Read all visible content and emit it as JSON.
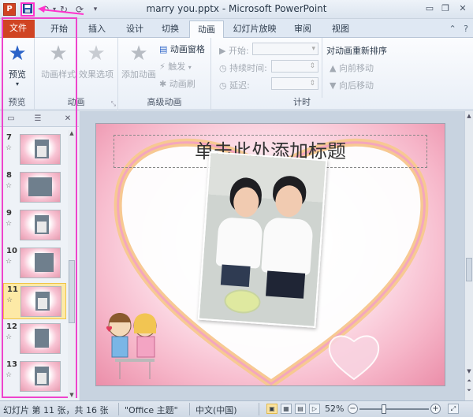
{
  "window": {
    "title": "marry you.pptx - Microsoft PowerPoint",
    "app_icon": "P",
    "controls": [
      "minimize-icon",
      "restore-icon",
      "close-icon"
    ]
  },
  "quick_access": {
    "icons": [
      "save-icon",
      "undo-icon",
      "redo-icon",
      "repeat-icon",
      "customize-dropdown-icon"
    ]
  },
  "tabs": [
    {
      "label": "文件",
      "type": "file"
    },
    {
      "label": "开始"
    },
    {
      "label": "插入"
    },
    {
      "label": "设计"
    },
    {
      "label": "切换"
    },
    {
      "label": "动画",
      "active": true
    },
    {
      "label": "幻灯片放映"
    },
    {
      "label": "审阅"
    },
    {
      "label": "视图"
    }
  ],
  "ribbon": {
    "preview": {
      "button": "预览",
      "group": "预览"
    },
    "animation": {
      "style_button": "动画样式",
      "effect_button": "效果选项",
      "group": "动画"
    },
    "advanced": {
      "add_button": "添加动画",
      "pane_button": "动画窗格",
      "trigger_button": "触发",
      "painter_button": "动画刷",
      "group": "高级动画"
    },
    "timing": {
      "start_label": "开始:",
      "duration_label": "持续时间:",
      "delay_label": "延迟:",
      "reorder_title": "对动画重新排序",
      "move_earlier": "向前移动",
      "move_later": "向后移动",
      "group": "计时"
    }
  },
  "thumbnails": [
    {
      "num": "7",
      "star": "☆"
    },
    {
      "num": "8",
      "star": "☆"
    },
    {
      "num": "9",
      "star": "☆"
    },
    {
      "num": "10",
      "star": "☆"
    },
    {
      "num": "11",
      "star": "☆",
      "selected": true
    },
    {
      "num": "12",
      "star": "☆"
    },
    {
      "num": "13",
      "star": "☆"
    }
  ],
  "slide": {
    "title_placeholder": "单击此处添加标题"
  },
  "status": {
    "slide_info": "幻灯片 第 11 张，共 16 张",
    "theme": "\"Office 主题\"",
    "language": "中文(中国)",
    "zoom": "52%"
  },
  "colors": {
    "file_tab": "#d04423",
    "highlight": "#ff33cc",
    "selected_thumb": "#fde9a6"
  }
}
